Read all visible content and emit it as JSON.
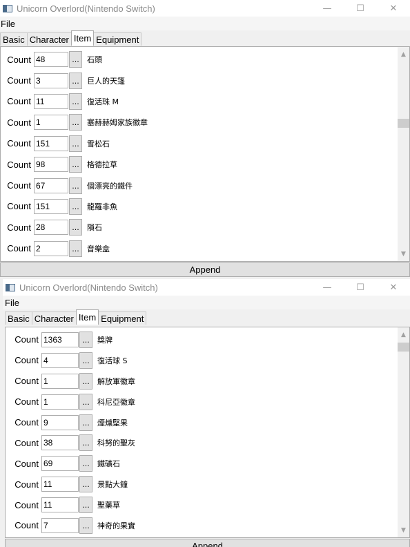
{
  "windows": [
    {
      "title": "Unicorn Overlord(Nintendo Switch)",
      "menu": "File",
      "tabs": [
        "Basic",
        "Character",
        "Item",
        "Equipment"
      ],
      "active_tab": "Item",
      "count_label": "Count",
      "browse_label": "...",
      "append_label": "Append",
      "items": [
        {
          "count": "48",
          "name": "石頭"
        },
        {
          "count": "3",
          "name": "巨人的天篷"
        },
        {
          "count": "11",
          "name": "復活珠 M"
        },
        {
          "count": "1",
          "name": "塞赫赫姆家族徽章"
        },
        {
          "count": "151",
          "name": "雪松石"
        },
        {
          "count": "98",
          "name": "格德拉草"
        },
        {
          "count": "67",
          "name": "個漂亮的鐵件"
        },
        {
          "count": "151",
          "name": "龍羅非魚"
        },
        {
          "count": "28",
          "name": "隕石"
        },
        {
          "count": "2",
          "name": "音樂盒"
        }
      ]
    },
    {
      "title": "Unicorn Overlord(Nintendo Switch)",
      "menu": "File",
      "tabs": [
        "Basic",
        "Character",
        "Item",
        "Equipment"
      ],
      "active_tab": "Item",
      "count_label": "Count",
      "browse_label": "...",
      "append_label": "Append",
      "items": [
        {
          "count": "1363",
          "name": "獎牌"
        },
        {
          "count": "4",
          "name": "復活球 S"
        },
        {
          "count": "1",
          "name": "解放軍徽章"
        },
        {
          "count": "1",
          "name": "科尼亞徽章"
        },
        {
          "count": "9",
          "name": "煙燻堅果"
        },
        {
          "count": "38",
          "name": "科努的聖灰"
        },
        {
          "count": "69",
          "name": "鐵礦石"
        },
        {
          "count": "11",
          "name": "景點大鐘"
        },
        {
          "count": "11",
          "name": "聖藥草"
        },
        {
          "count": "7",
          "name": "神奇的果實"
        }
      ]
    }
  ],
  "window_controls": {
    "minimize": "—",
    "maximize": "☐",
    "close": "✕"
  },
  "colors": {
    "title_text": "#8a8a8a",
    "content_bg": "#ffffff",
    "button_bg": "#e1e1e1"
  }
}
